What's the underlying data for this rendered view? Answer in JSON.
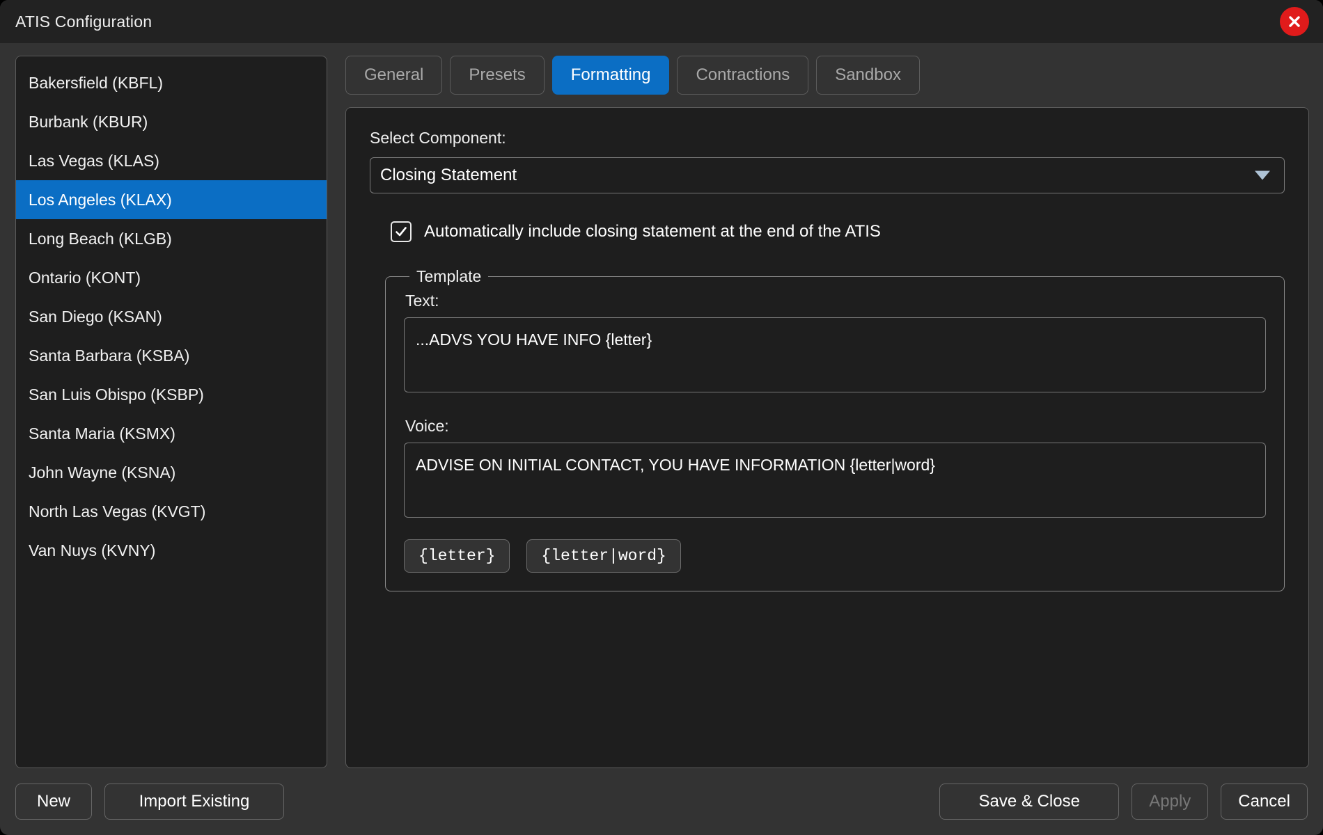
{
  "window": {
    "title": "ATIS Configuration",
    "close_icon": "close-icon"
  },
  "sidebar": {
    "stations": [
      {
        "label": "Bakersfield (KBFL)",
        "selected": false
      },
      {
        "label": "Burbank (KBUR)",
        "selected": false
      },
      {
        "label": "Las Vegas (KLAS)",
        "selected": false
      },
      {
        "label": "Los Angeles (KLAX)",
        "selected": true
      },
      {
        "label": "Long Beach (KLGB)",
        "selected": false
      },
      {
        "label": "Ontario (KONT)",
        "selected": false
      },
      {
        "label": "San Diego (KSAN)",
        "selected": false
      },
      {
        "label": "Santa Barbara (KSBA)",
        "selected": false
      },
      {
        "label": "San Luis Obispo (KSBP)",
        "selected": false
      },
      {
        "label": "Santa Maria (KSMX)",
        "selected": false
      },
      {
        "label": "John Wayne (KSNA)",
        "selected": false
      },
      {
        "label": "North Las Vegas (KVGT)",
        "selected": false
      },
      {
        "label": "Van Nuys (KVNY)",
        "selected": false
      }
    ]
  },
  "tabs": [
    {
      "label": "General",
      "active": false
    },
    {
      "label": "Presets",
      "active": false
    },
    {
      "label": "Formatting",
      "active": true
    },
    {
      "label": "Contractions",
      "active": false
    },
    {
      "label": "Sandbox",
      "active": false
    }
  ],
  "formatting": {
    "select_component_label": "Select Component:",
    "selected_component": "Closing Statement",
    "dropdown_icon": "chevron-down-icon",
    "auto_include": {
      "label": "Automatically include closing statement at the end of the ATIS",
      "checked": true,
      "check_icon": "check-icon"
    },
    "template": {
      "legend": "Template",
      "text_label": "Text:",
      "text_value": "...ADVS YOU HAVE INFO {letter}",
      "voice_label": "Voice:",
      "voice_value": "ADVISE ON INITIAL CONTACT, YOU HAVE INFORMATION {letter|word}",
      "tokens": [
        {
          "label": "{letter}"
        },
        {
          "label": "{letter|word}"
        }
      ]
    }
  },
  "footer": {
    "new_label": "New",
    "import_label": "Import Existing",
    "save_close_label": "Save & Close",
    "apply_label": "Apply",
    "apply_disabled": true,
    "cancel_label": "Cancel"
  },
  "colors": {
    "accent": "#0b6ec4",
    "close": "#e01b1b",
    "panel_bg": "#1e1e1e",
    "window_bg": "#333333",
    "titlebar_bg": "#222222"
  }
}
